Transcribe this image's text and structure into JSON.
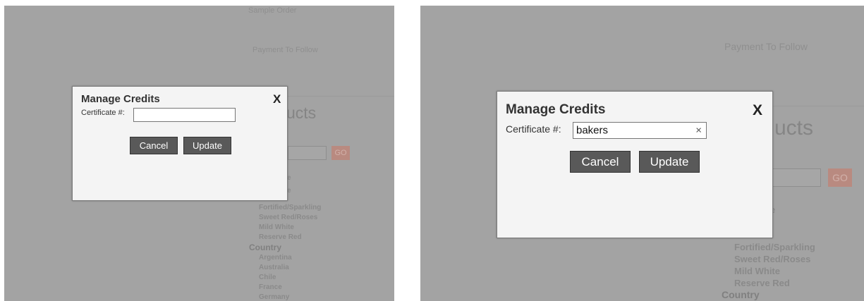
{
  "left": {
    "page_links": [
      "Sample Order",
      "Payment To Follow"
    ],
    "heading_fragment": "ucts",
    "go_button": "GO",
    "categories": [
      {
        "label": "e",
        "head": false
      },
      {
        "label": "e",
        "head": false
      },
      {
        "label": "Fortified/Sparkling",
        "head": false
      },
      {
        "label": "Sweet Red/Roses",
        "head": false
      },
      {
        "label": "Mild White",
        "head": false
      },
      {
        "label": "Reserve Red",
        "head": false
      },
      {
        "label": "Country",
        "head": true
      },
      {
        "label": "Argentina",
        "head": false
      },
      {
        "label": "Australia",
        "head": false
      },
      {
        "label": "Chile",
        "head": false
      },
      {
        "label": "France",
        "head": false
      },
      {
        "label": "Germany",
        "head": false
      }
    ],
    "modal": {
      "title": "Manage Credits",
      "close": "X",
      "certificate_label": "Certificate #:",
      "certificate_value": "",
      "cancel": "Cancel",
      "update": "Update"
    }
  },
  "right": {
    "page_links": [
      "Payment To Follow"
    ],
    "heading_fragment": "ucts",
    "go_button": "GO",
    "categories": [
      {
        "label": "e",
        "head": false
      },
      {
        "label": "te",
        "head": false
      },
      {
        "label": "Fortified/Sparkling",
        "head": false
      },
      {
        "label": "Sweet Red/Roses",
        "head": false
      },
      {
        "label": "Mild White",
        "head": false
      },
      {
        "label": "Reserve Red",
        "head": false
      },
      {
        "label": "Country",
        "head": true
      }
    ],
    "modal": {
      "title": "Manage Credits",
      "close": "X",
      "certificate_label": "Certificate #:",
      "certificate_value": "bakers",
      "clear_icon": "×",
      "cancel": "Cancel",
      "update": "Update"
    }
  },
  "colors": {
    "overlay": "#a3a3a3",
    "modal_bg": "#f4f4f4",
    "button_bg": "#595959",
    "go_button_bg": "#b98a80"
  }
}
